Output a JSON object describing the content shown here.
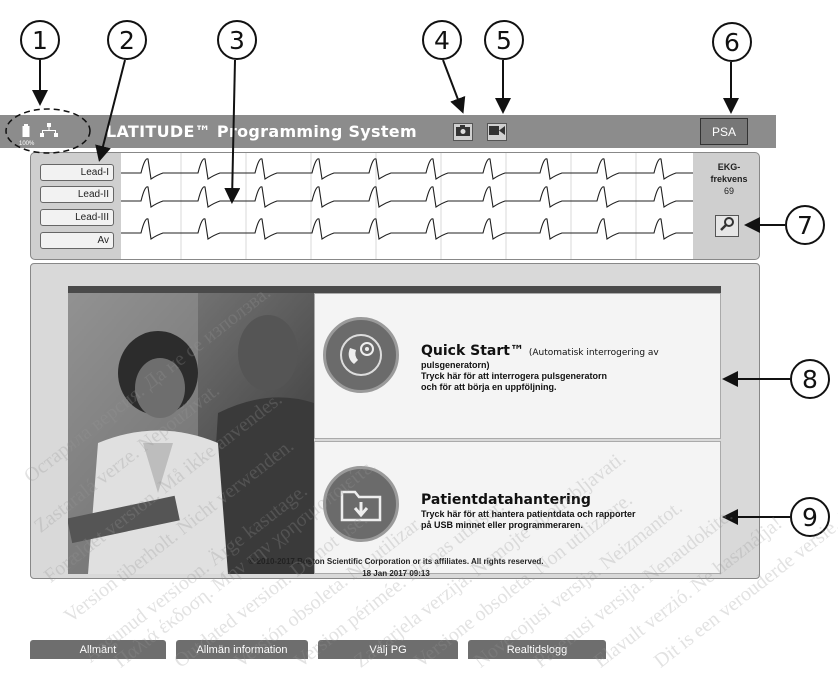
{
  "callouts": [
    "1",
    "2",
    "3",
    "4",
    "5",
    "6",
    "7",
    "8",
    "9"
  ],
  "title_bar": {
    "app_title": "LATITUDE™ Programming System",
    "battery_percent": "100%",
    "battery_icon": "battery-icon",
    "network_icon": "network-icon",
    "camera_icon": "camera-icon",
    "video_icon": "video-icon",
    "psa_label": "PSA"
  },
  "ecg": {
    "leads": [
      "Lead-I",
      "Lead-II",
      "Lead-III",
      "Av"
    ],
    "rate_label_1": "EKG-",
    "rate_label_2": "frekvens",
    "rate_value": "69",
    "magnify_icon": "magnify-icon"
  },
  "main": {
    "quick_start": {
      "title": "Quick Start™",
      "title_suffix": "(Automatisk interrogering av",
      "line2": "pulsgeneratorn)",
      "line3": "Tryck här för att interrogera pulsgeneratorn",
      "line4": "och för att börja en uppföljning.",
      "icon": "quick-start-icon"
    },
    "patient_data": {
      "title": "Patientdatahantering",
      "line2": "Tryck här för att hantera patientdata och rapporter",
      "line3": "på USB minnet eller programmeraren.",
      "icon": "folder-icon"
    },
    "copyright": "© 2010-2017 Boston Scientific Corporation or its affiliates. All rights reserved.",
    "datetime": "18 Jan 2017 09:13"
  },
  "tabs": [
    "Allmänt",
    "Allmän information",
    "Välj PG",
    "Realtidslogg"
  ],
  "watermark": [
    "Остаряла версия. Да не се използва.",
    "Zastaralá verze. Nepoužívat.",
    "Forældet version. Må ikke anvendes.",
    "Version überholt. Nicht verwenden.",
    "Aegunud versioon. Ärge kasutage.",
    "Παλιά έκδοση. Μην την χρησιμοποιείτε.",
    "Outdated version. Do not use.",
    "Versión obsoleta. No utilizar.",
    "Version périmée. Ne pas utiliser.",
    "Zastarjela verzija. Nemojte upotrebljavati.",
    "Versione obsoleta. Non utilizzare.",
    "Novecojusi versija. Neizmantot.",
    "Pasenusi versija. Nenaudokite.",
    "Elavult verzió. Ne használja!",
    "Dit is een verouderde versie. Niet gebruiken."
  ]
}
